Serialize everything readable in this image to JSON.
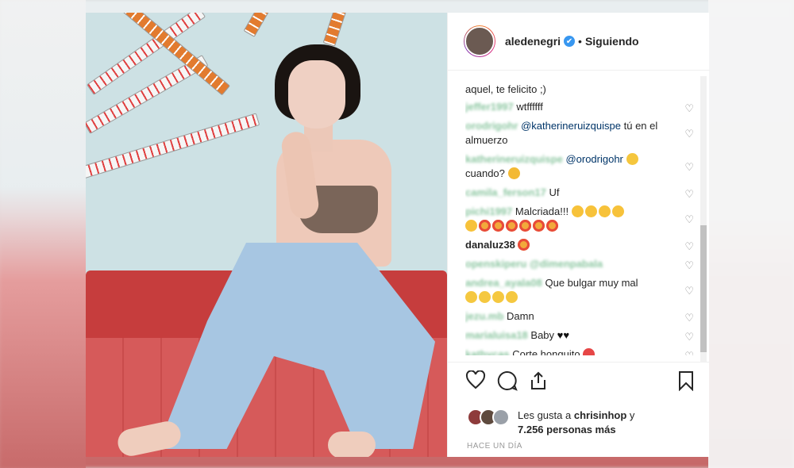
{
  "post": {
    "username": "aledenegri",
    "follow_status": "Siguiendo",
    "separator": "•",
    "verified_mark": "✔"
  },
  "comments": [
    {
      "user": "",
      "text": "aquel, te felicito ;)",
      "user_blurred": false
    },
    {
      "user": "jeffer1997",
      "text": "wtffffff",
      "user_blurred": true
    },
    {
      "user": "orodrigohr",
      "mention": "@katherineruizquispe",
      "text": "tú en el almuerzo",
      "user_blurred": true
    },
    {
      "user": "katherineruizquispe",
      "mention": "@orodrigohr",
      "text": "cuando?",
      "user_blurred": true
    },
    {
      "user": "camila_ferson17",
      "text": "Uf",
      "user_blurred": true
    },
    {
      "user": "pichi1997",
      "text": "Malcriada!!!",
      "user_blurred": true
    },
    {
      "user": "danaluz38",
      "text": "",
      "user_blurred": false
    },
    {
      "user": "openskiperu",
      "text": "@dimenpabala",
      "user_blurred": true
    },
    {
      "user": "andrea_ayala08",
      "text": "Que bulgar muy mal",
      "user_blurred": true
    },
    {
      "user": "jezu.mb",
      "text": "Damn",
      "user_blurred": true
    },
    {
      "user": "marialuisa18",
      "text": "Baby",
      "hearts": "♥♥",
      "user_blurred": true
    },
    {
      "user": "kathycas",
      "text": "Corte honguito",
      "user_blurred": true
    }
  ],
  "heart_icon": "♡",
  "likes": {
    "prefix": "Les gusta a",
    "user": "chrisinhop",
    "conjunction": "y",
    "count": "7.256 personas más"
  },
  "timestamp": "HACE UN DÍA",
  "icons": {
    "like": "heart-outline-icon",
    "comment": "comment-bubble-icon",
    "share": "share-icon",
    "save": "bookmark-icon"
  },
  "colors": {
    "verified": "#3897f0",
    "mention": "#003569",
    "text": "#262626",
    "muted": "#999999"
  }
}
